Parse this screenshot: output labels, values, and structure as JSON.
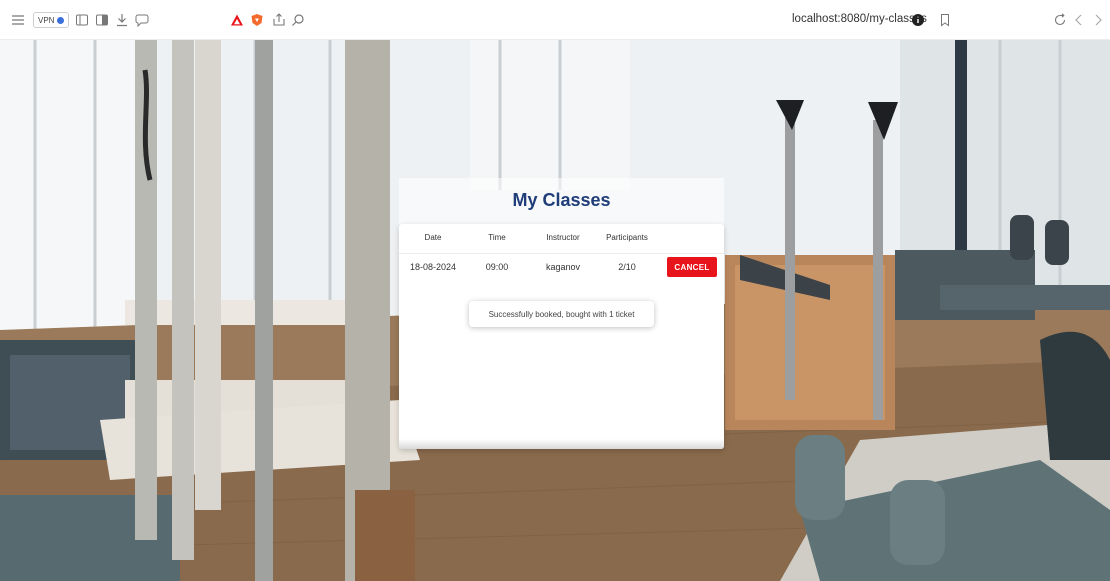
{
  "browser": {
    "vpn_label": "VPN",
    "url": "localhost:8080/my-classes",
    "icons": [
      "menu-icon",
      "sidebar-icon",
      "reader-icon",
      "download-icon",
      "chat-icon",
      "brave-rewards-icon",
      "brave-shields-icon",
      "share-icon",
      "search-icon",
      "info-icon",
      "bookmark-icon",
      "reload-icon",
      "back-icon",
      "forward-icon"
    ]
  },
  "page": {
    "title": "My Classes",
    "table": {
      "headers": [
        "Date",
        "Time",
        "Instructor",
        "Participants"
      ],
      "rows": [
        {
          "date": "18-08-2024",
          "time": "09:00",
          "instructor": "kaganov",
          "participants": "2/10",
          "action": "CANCEL"
        }
      ]
    },
    "toast": "Successfully booked, bought with 1 ticket"
  },
  "colors": {
    "title": "#1f3d78",
    "cancel": "#e8141b"
  }
}
